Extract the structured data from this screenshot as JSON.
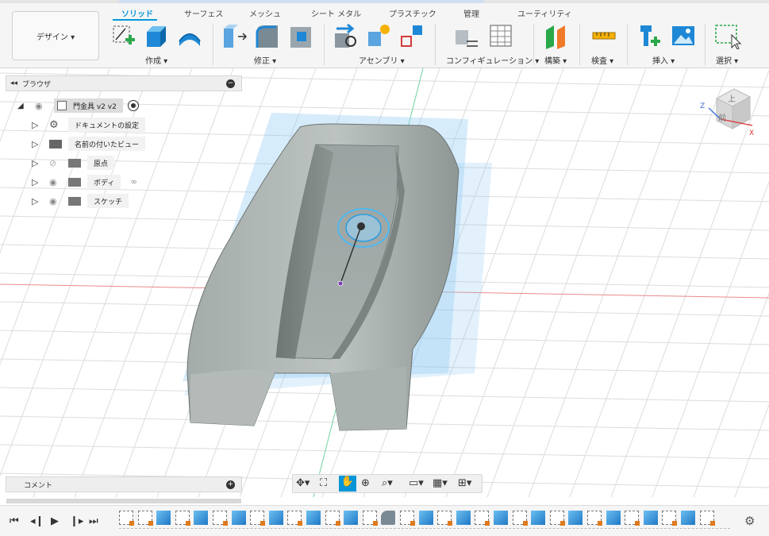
{
  "toolbar": {
    "design_label": "デザイン ▾",
    "tabs": [
      {
        "label": "ソリッド",
        "active": true
      },
      {
        "label": "サーフェス"
      },
      {
        "label": "メッシュ"
      },
      {
        "label": "シート メタル"
      },
      {
        "label": "プラスチック"
      },
      {
        "label": "管理"
      },
      {
        "label": "ユーティリティ"
      }
    ],
    "groups": {
      "create": "作成 ▾",
      "modify": "修正 ▾",
      "assemble": "アセンブリ ▾",
      "configure": "コンフィギュレーション ▾",
      "construct": "構築 ▾",
      "inspect": "検査 ▾",
      "insert": "挿入 ▾",
      "select": "選択 ▾"
    }
  },
  "browser": {
    "title": "ブラウザ",
    "root": "門金具 v2 v2",
    "items": [
      {
        "label": "ドキュメントの設定",
        "icon": "gear-icon"
      },
      {
        "label": "名前の付いたビュー",
        "icon": "folder-icon"
      },
      {
        "label": "原点",
        "icon": "folder-icon",
        "hidden": true
      },
      {
        "label": "ボディ",
        "icon": "folder-icon"
      },
      {
        "label": "スケッチ",
        "icon": "folder-icon"
      }
    ]
  },
  "viewcube": {
    "top": "上",
    "front": "前",
    "z": "Z",
    "x": "X"
  },
  "comment": {
    "label": "コメント"
  },
  "colors": {
    "accent": "#0696d7",
    "model": "#9aa2a0",
    "grid": "#d9d9d9",
    "x_axis": "#e05050",
    "y_axis": "#3ec07a"
  }
}
